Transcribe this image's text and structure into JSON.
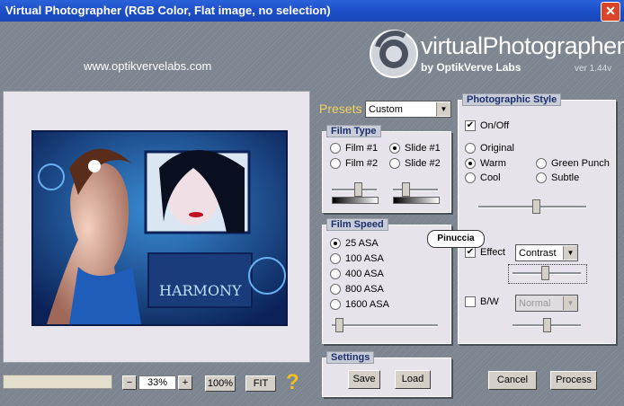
{
  "window": {
    "title": "Virtual Photographer (RGB Color, Flat image, no selection)",
    "close": "✕"
  },
  "header": {
    "url": "www.optikvervelabs.com",
    "logo_name": "virtualPhotographer",
    "logo_by": "by OptikVerve Labs",
    "version": "ver 1.44v"
  },
  "presets": {
    "label": "Presets",
    "value": "Custom"
  },
  "film_type": {
    "title": "Film Type",
    "film1": "Film #1",
    "film2": "Film #2",
    "slide1": "Slide #1",
    "slide2": "Slide #2",
    "selected": "Slide #1",
    "slider1": 0.5,
    "slider2": 0.25
  },
  "film_speed": {
    "title": "Film Speed",
    "options": [
      "25 ASA",
      "100 ASA",
      "400 ASA",
      "800 ASA",
      "1600 ASA"
    ],
    "selected": "25 ASA",
    "slider": 0.05
  },
  "settings": {
    "title": "Settings",
    "save": "Save",
    "load": "Load"
  },
  "photo_style": {
    "title": "Photographic Style",
    "onoff": "On/Off",
    "onoff_checked": true,
    "original": "Original",
    "warm": "Warm",
    "cool": "Cool",
    "green_punch": "Green Punch",
    "subtle": "Subtle",
    "selected": "Warm",
    "slider": 0.55,
    "effect": "Effect",
    "effect_checked": true,
    "effect_value": "Contrast",
    "effect_slider": 0.45,
    "bw": "B/W",
    "bw_checked": false,
    "bw_value": "Normal",
    "bw_slider": 0.5
  },
  "watermark": "Pinuccia",
  "zoom": {
    "minus": "−",
    "value": "33%",
    "plus": "+",
    "hundred": "100%",
    "fit": "FIT",
    "help": "?"
  },
  "actions": {
    "cancel": "Cancel",
    "process": "Process"
  },
  "preview_caption": "HARMONY"
}
